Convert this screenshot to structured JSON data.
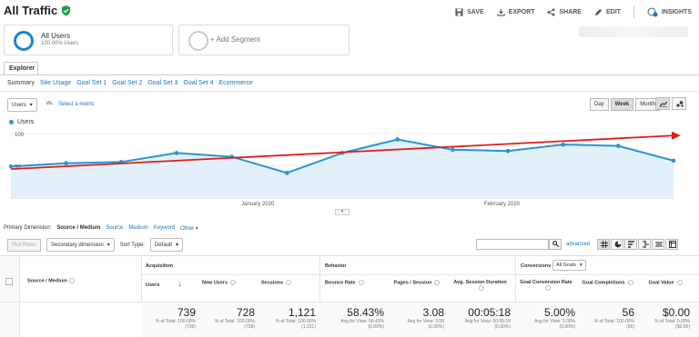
{
  "header": {
    "title": "All Traffic"
  },
  "toolbar": {
    "save": "SAVE",
    "export": "EXPORT",
    "share": "SHARE",
    "edit": "EDIT",
    "insights": "INSIGHTS"
  },
  "segments": {
    "seg1_title": "All Users",
    "seg1_sub": "100.00% Users",
    "add_segment": "+ Add Segment"
  },
  "explorer_tab": "Explorer",
  "subtabs": [
    "Summary",
    "Site Usage",
    "Goal Set 1",
    "Goal Set 2",
    "Goal Set 3",
    "Goal Set 4",
    "Ecommerce"
  ],
  "controls": {
    "metric": "Users",
    "vs": "vs.",
    "select_metric": "Select a metric",
    "day": "Day",
    "week": "Week",
    "month": "Month"
  },
  "chart_data": {
    "type": "line",
    "legend": "Users",
    "ytick_top": "100",
    "ytick_mid": "50",
    "xticks": [
      "January 2020",
      "February 2020"
    ],
    "values": [
      49,
      54,
      56,
      70,
      64,
      39,
      70,
      91,
      75,
      73,
      83,
      81,
      58
    ],
    "trend": [
      45,
      97
    ],
    "ylim": [
      0,
      110
    ],
    "colors": {
      "line": "#2a94d1",
      "fill": "#e2f0fa",
      "trend": "#e21b1b"
    }
  },
  "dimension": {
    "label": "Primary Dimension:",
    "active": "Source / Medium",
    "others": [
      "Source",
      "Medium",
      "Keyword",
      "Other"
    ]
  },
  "table_controls": {
    "plot_rows": "Plot Rows",
    "secondary": "Secondary dimension",
    "sort_type_label": "Sort Type:",
    "sort_type": "Default",
    "advanced": "advanced"
  },
  "table": {
    "groups": {
      "acquisition": "Acquisition",
      "behavior": "Behavior",
      "conversions": "Conversions",
      "all_goals": "All Goals"
    },
    "dim_header": "Source / Medium",
    "columns": [
      {
        "label": "Users",
        "value": "739",
        "sub1": "% of Total: 100.00%",
        "sub2": "(739)"
      },
      {
        "label": "New Users",
        "value": "728",
        "sub1": "% of Total: 100.00%",
        "sub2": "(728)"
      },
      {
        "label": "Sessions",
        "value": "1,121",
        "sub1": "% of Total: 100.00%",
        "sub2": "(1,121)"
      },
      {
        "label": "Bounce Rate",
        "value": "58.43%",
        "sub1": "Avg for View: 58.43%",
        "sub2": "(0.00%)"
      },
      {
        "label": "Pages / Session",
        "value": "3.08",
        "sub1": "Avg for View: 3.08",
        "sub2": "(0.00%)"
      },
      {
        "label": "Avg. Session Duration",
        "value": "00:05:18",
        "sub1": "Avg for View: 00:05:18",
        "sub2": "(0.00%)"
      },
      {
        "label": "Goal Conversion Rate",
        "value": "5.00%",
        "sub1": "Avg for View: 5.00%",
        "sub2": "(0.00%)"
      },
      {
        "label": "Goal Completions",
        "value": "56",
        "sub1": "% of Total: 100.00%",
        "sub2": "(56)"
      },
      {
        "label": "Goal Value",
        "value": "$0.00",
        "sub1": "% of Total: 0.00%",
        "sub2": "($0.00)"
      }
    ]
  }
}
